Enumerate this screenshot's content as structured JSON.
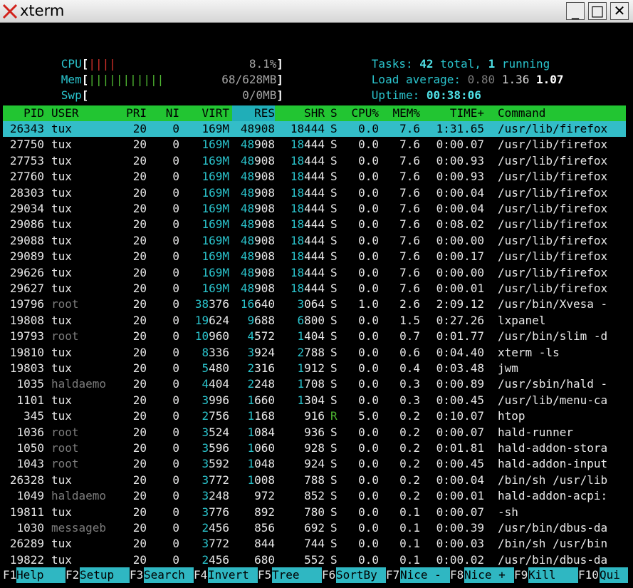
{
  "window": {
    "title": "xterm",
    "minimize": "_",
    "maximize": "□",
    "close": "✕"
  },
  "meters": {
    "cpu": {
      "label": "CPU",
      "bars": "||||",
      "value": "8.1%",
      "bracket_open": "[",
      "bracket_close": "]"
    },
    "mem": {
      "label": "Mem",
      "bars": "|||||||||||",
      "value": "68/628MB",
      "bracket_open": "[",
      "bracket_close": "]"
    },
    "swp": {
      "label": "Swp",
      "bars": "",
      "value": "0/0MB",
      "bracket_open": "[",
      "bracket_close": "]"
    }
  },
  "summary": {
    "tasks_label": "Tasks: ",
    "tasks_total": "42",
    "tasks_total_suffix": " total, ",
    "tasks_running": "1",
    "tasks_running_suffix": " running",
    "load_label": "Load average: ",
    "load_1": "0.80",
    "load_5": "1.36",
    "load_15": "1.07",
    "uptime_label": "Uptime: ",
    "uptime": "00:38:06"
  },
  "columns": [
    "PID",
    "USER",
    "PRI",
    "NI",
    "VIRT",
    "RES",
    "SHR",
    "S",
    "CPU%",
    "MEM%",
    "TIME+",
    "Command"
  ],
  "processes": [
    {
      "pid": "26343",
      "user": "tux",
      "pri": "20",
      "ni": "0",
      "virt": "169M",
      "res": "48908",
      "shr": "18444",
      "s": "S",
      "cpu": "0.0",
      "mem": "7.6",
      "time": "1:31.65",
      "cmd": "/usr/lib/firefox"
    },
    {
      "pid": "27750",
      "user": "tux",
      "pri": "20",
      "ni": "0",
      "virt": "169M",
      "res": "48908",
      "shr": "18444",
      "s": "S",
      "cpu": "0.0",
      "mem": "7.6",
      "time": "0:00.07",
      "cmd": "/usr/lib/firefox"
    },
    {
      "pid": "27753",
      "user": "tux",
      "pri": "20",
      "ni": "0",
      "virt": "169M",
      "res": "48908",
      "shr": "18444",
      "s": "S",
      "cpu": "0.0",
      "mem": "7.6",
      "time": "0:00.93",
      "cmd": "/usr/lib/firefox"
    },
    {
      "pid": "27760",
      "user": "tux",
      "pri": "20",
      "ni": "0",
      "virt": "169M",
      "res": "48908",
      "shr": "18444",
      "s": "S",
      "cpu": "0.0",
      "mem": "7.6",
      "time": "0:00.93",
      "cmd": "/usr/lib/firefox"
    },
    {
      "pid": "28303",
      "user": "tux",
      "pri": "20",
      "ni": "0",
      "virt": "169M",
      "res": "48908",
      "shr": "18444",
      "s": "S",
      "cpu": "0.0",
      "mem": "7.6",
      "time": "0:00.04",
      "cmd": "/usr/lib/firefox"
    },
    {
      "pid": "29034",
      "user": "tux",
      "pri": "20",
      "ni": "0",
      "virt": "169M",
      "res": "48908",
      "shr": "18444",
      "s": "S",
      "cpu": "0.0",
      "mem": "7.6",
      "time": "0:00.04",
      "cmd": "/usr/lib/firefox"
    },
    {
      "pid": "29086",
      "user": "tux",
      "pri": "20",
      "ni": "0",
      "virt": "169M",
      "res": "48908",
      "shr": "18444",
      "s": "S",
      "cpu": "0.0",
      "mem": "7.6",
      "time": "0:08.02",
      "cmd": "/usr/lib/firefox"
    },
    {
      "pid": "29088",
      "user": "tux",
      "pri": "20",
      "ni": "0",
      "virt": "169M",
      "res": "48908",
      "shr": "18444",
      "s": "S",
      "cpu": "0.0",
      "mem": "7.6",
      "time": "0:00.00",
      "cmd": "/usr/lib/firefox"
    },
    {
      "pid": "29089",
      "user": "tux",
      "pri": "20",
      "ni": "0",
      "virt": "169M",
      "res": "48908",
      "shr": "18444",
      "s": "S",
      "cpu": "0.0",
      "mem": "7.6",
      "time": "0:00.17",
      "cmd": "/usr/lib/firefox"
    },
    {
      "pid": "29626",
      "user": "tux",
      "pri": "20",
      "ni": "0",
      "virt": "169M",
      "res": "48908",
      "shr": "18444",
      "s": "S",
      "cpu": "0.0",
      "mem": "7.6",
      "time": "0:00.00",
      "cmd": "/usr/lib/firefox"
    },
    {
      "pid": "29627",
      "user": "tux",
      "pri": "20",
      "ni": "0",
      "virt": "169M",
      "res": "48908",
      "shr": "18444",
      "s": "S",
      "cpu": "0.0",
      "mem": "7.6",
      "time": "0:00.01",
      "cmd": "/usr/lib/firefox"
    },
    {
      "pid": "19796",
      "user": "root",
      "pri": "20",
      "ni": "0",
      "virt": "38376",
      "res": "16640",
      "shr": "3064",
      "s": "S",
      "cpu": "1.0",
      "mem": "2.6",
      "time": "2:09.12",
      "cmd": "/usr/bin/Xvesa -"
    },
    {
      "pid": "19808",
      "user": "tux",
      "pri": "20",
      "ni": "0",
      "virt": "19624",
      "res": "9688",
      "shr": "6800",
      "s": "S",
      "cpu": "0.0",
      "mem": "1.5",
      "time": "0:27.26",
      "cmd": "lxpanel"
    },
    {
      "pid": "19793",
      "user": "root",
      "pri": "20",
      "ni": "0",
      "virt": "10960",
      "res": "4572",
      "shr": "1404",
      "s": "S",
      "cpu": "0.0",
      "mem": "0.7",
      "time": "0:01.77",
      "cmd": "/usr/bin/slim -d"
    },
    {
      "pid": "19810",
      "user": "tux",
      "pri": "20",
      "ni": "0",
      "virt": "8336",
      "res": "3924",
      "shr": "2788",
      "s": "S",
      "cpu": "0.0",
      "mem": "0.6",
      "time": "0:04.40",
      "cmd": "xterm -ls"
    },
    {
      "pid": "19803",
      "user": "tux",
      "pri": "20",
      "ni": "0",
      "virt": "5480",
      "res": "2316",
      "shr": "1912",
      "s": "S",
      "cpu": "0.0",
      "mem": "0.4",
      "time": "0:03.48",
      "cmd": "jwm"
    },
    {
      "pid": "1035",
      "user": "haldaemo",
      "pri": "20",
      "ni": "0",
      "virt": "4404",
      "res": "2248",
      "shr": "1708",
      "s": "S",
      "cpu": "0.0",
      "mem": "0.3",
      "time": "0:00.89",
      "cmd": "/usr/sbin/hald -"
    },
    {
      "pid": "1101",
      "user": "tux",
      "pri": "20",
      "ni": "0",
      "virt": "3996",
      "res": "1660",
      "shr": "1304",
      "s": "S",
      "cpu": "0.0",
      "mem": "0.3",
      "time": "0:00.45",
      "cmd": "/usr/lib/menu-ca"
    },
    {
      "pid": "345",
      "user": "tux",
      "pri": "20",
      "ni": "0",
      "virt": "2756",
      "res": "1168",
      "shr": "916",
      "s": "R",
      "cpu": "5.0",
      "mem": "0.2",
      "time": "0:10.07",
      "cmd": "htop"
    },
    {
      "pid": "1036",
      "user": "root",
      "pri": "20",
      "ni": "0",
      "virt": "3524",
      "res": "1084",
      "shr": "936",
      "s": "S",
      "cpu": "0.0",
      "mem": "0.2",
      "time": "0:00.07",
      "cmd": "hald-runner"
    },
    {
      "pid": "1050",
      "user": "root",
      "pri": "20",
      "ni": "0",
      "virt": "3596",
      "res": "1060",
      "shr": "928",
      "s": "S",
      "cpu": "0.0",
      "mem": "0.2",
      "time": "0:01.81",
      "cmd": "hald-addon-stora"
    },
    {
      "pid": "1043",
      "user": "root",
      "pri": "20",
      "ni": "0",
      "virt": "3592",
      "res": "1048",
      "shr": "924",
      "s": "S",
      "cpu": "0.0",
      "mem": "0.2",
      "time": "0:00.45",
      "cmd": "hald-addon-input"
    },
    {
      "pid": "26328",
      "user": "tux",
      "pri": "20",
      "ni": "0",
      "virt": "3772",
      "res": "1008",
      "shr": "788",
      "s": "S",
      "cpu": "0.0",
      "mem": "0.2",
      "time": "0:00.04",
      "cmd": "/bin/sh /usr/lib"
    },
    {
      "pid": "1049",
      "user": "haldaemo",
      "pri": "20",
      "ni": "0",
      "virt": "3248",
      "res": "972",
      "shr": "852",
      "s": "S",
      "cpu": "0.0",
      "mem": "0.2",
      "time": "0:00.01",
      "cmd": "hald-addon-acpi:"
    },
    {
      "pid": "19811",
      "user": "tux",
      "pri": "20",
      "ni": "0",
      "virt": "3776",
      "res": "892",
      "shr": "780",
      "s": "S",
      "cpu": "0.0",
      "mem": "0.1",
      "time": "0:00.07",
      "cmd": "-sh"
    },
    {
      "pid": "1030",
      "user": "messageb",
      "pri": "20",
      "ni": "0",
      "virt": "2456",
      "res": "856",
      "shr": "692",
      "s": "S",
      "cpu": "0.0",
      "mem": "0.1",
      "time": "0:00.39",
      "cmd": "/usr/bin/dbus-da"
    },
    {
      "pid": "26289",
      "user": "tux",
      "pri": "20",
      "ni": "0",
      "virt": "3772",
      "res": "844",
      "shr": "744",
      "s": "S",
      "cpu": "0.0",
      "mem": "0.1",
      "time": "0:00.03",
      "cmd": "/bin/sh /usr/bin"
    },
    {
      "pid": "19822",
      "user": "tux",
      "pri": "20",
      "ni": "0",
      "virt": "2456",
      "res": "680",
      "shr": "552",
      "s": "S",
      "cpu": "0.0",
      "mem": "0.1",
      "time": "0:00.02",
      "cmd": "/usr/bin/dbus-da"
    }
  ],
  "function_keys": [
    {
      "key": "F1",
      "label": "Help"
    },
    {
      "key": "F2",
      "label": "Setup"
    },
    {
      "key": "F3",
      "label": "Search"
    },
    {
      "key": "F4",
      "label": "Invert"
    },
    {
      "key": "F5",
      "label": "Tree"
    },
    {
      "key": "F6",
      "label": "SortBy"
    },
    {
      "key": "F7",
      "label": "Nice -"
    },
    {
      "key": "F8",
      "label": "Nice +"
    },
    {
      "key": "F9",
      "label": "Kill"
    },
    {
      "key": "F10",
      "label": "Qui"
    }
  ],
  "colors": {
    "header_bg": "#22c532",
    "selected_bg": "#33bdc8",
    "fkey_label_bg": "#2fb7c2",
    "cyan": "#2ac3cc",
    "terminal_bg": "#000000"
  }
}
